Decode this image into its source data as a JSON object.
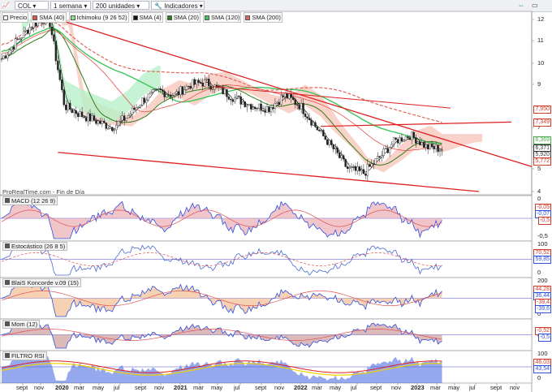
{
  "toolbar": {
    "symbol": "COL",
    "period": "1 semana",
    "units": "200 unidades",
    "indicators_label": "Indicadores"
  },
  "main_panel": {
    "legend": [
      {
        "label": "Precio",
        "color": "#ffffff"
      },
      {
        "label": "SMA (40)",
        "color": "#e5524d"
      },
      {
        "label": "Ichimoku (9 26 52)",
        "color": "#8fe08f"
      },
      {
        "label": "SMA (4)",
        "color": "#111111"
      },
      {
        "label": "SMA (20)",
        "color": "#2e7d1e"
      },
      {
        "label": "SMA (120)",
        "color": "#3ec45a"
      },
      {
        "label": "SMA (200)",
        "color": "#e0655c"
      }
    ],
    "y_ticks": [
      "12",
      "11",
      "10",
      "9",
      "7",
      "6",
      "5",
      "4"
    ],
    "price_tags": [
      {
        "text": "7,950",
        "color": "#d23a2a"
      },
      {
        "text": "7,349",
        "color": "#d23a2a"
      },
      {
        "text": "6,369",
        "color": "#4aa84a"
      },
      {
        "text": "6,371",
        "color": "#333333"
      },
      {
        "text": "5,920",
        "color": "#333333"
      },
      {
        "text": "5,772",
        "color": "#d23a2a"
      }
    ],
    "source": "ProRealTime.com - Fin de Día"
  },
  "panels": [
    {
      "id": "macd",
      "title": "MACD (12 26 9)",
      "ticks": [
        "0",
        "-0,5"
      ],
      "tags": [
        "-0,05",
        "-0,07",
        "-0,5"
      ]
    },
    {
      "id": "stoch",
      "title": "Estocástico (26 8 5)",
      "ticks": [
        "100",
        "50",
        "0"
      ],
      "tags": [
        "70,52",
        "59,85"
      ]
    },
    {
      "id": "koncorde",
      "title": "BlaiS Koncorde v.09 (15)",
      "ticks": [
        "200",
        "0"
      ],
      "tags": [
        "44,28",
        "36,44",
        "-39,4",
        "-39,6"
      ]
    },
    {
      "id": "mom",
      "title": "Mom (12)",
      "ticks": [
        "0"
      ],
      "tags": [
        "-0,52",
        "-0,5"
      ]
    },
    {
      "id": "rsi",
      "title": "FILTRO RSI",
      "ticks": [
        "100",
        "50",
        "0"
      ],
      "tags": [
        "46,03",
        "43,54"
      ]
    }
  ],
  "x_axis": [
    "sept",
    "nov",
    "2020",
    "mar",
    "may",
    "jul",
    "sept",
    "nov",
    "2021",
    "mar",
    "may",
    "jul",
    "sept",
    "nov",
    "2022",
    "mar",
    "may",
    "jul",
    "sept",
    "nov",
    "2023",
    "mar",
    "may",
    "jul",
    "sept",
    "nov"
  ],
  "chart_data": {
    "type": "candlestick",
    "note_x_range": "2019-08 to 2023-11 weekly",
    "price_samples": [
      10.2,
      11.0,
      11.8,
      12.1,
      8.0,
      7.6,
      7.3,
      7.0,
      7.5,
      8.3,
      8.7,
      8.5,
      9.0,
      9.1,
      8.7,
      8.3,
      8.0,
      7.9,
      8.5,
      8.0,
      7.0,
      6.0,
      5.0,
      4.8,
      5.5,
      6.3,
      6.6,
      6.0,
      5.9
    ],
    "resistance_line": {
      "from": "12.1 (2019-12)",
      "to": "5.1 (2023-11)"
    },
    "support_line": {
      "from": "5.7 (2020-02)",
      "to": "3.9 (2023-11)"
    }
  },
  "colors": {
    "red_line": "#e02020",
    "cloud_green": "#a7ecc0",
    "cloud_red": "#f7b7a8",
    "macd_blue": "#3050e0",
    "rsi_yellow": "#f0d000"
  }
}
